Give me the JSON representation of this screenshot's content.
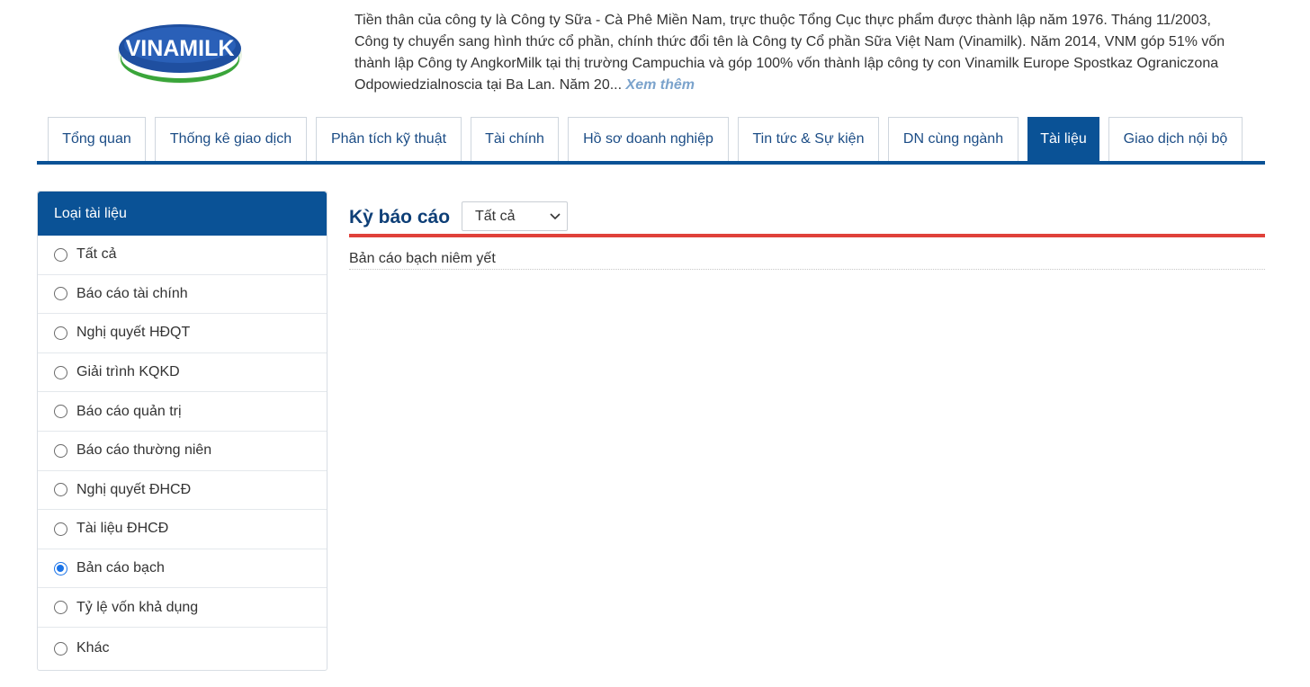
{
  "logo": {
    "text": "VINAMILK",
    "colors": {
      "blue": "#1f4fa0",
      "green": "#3aa53a",
      "white": "#ffffff"
    }
  },
  "intro": {
    "text": "Tiền thân của công ty là Công ty Sữa - Cà Phê Miền Nam, trực thuộc Tổng Cục thực phẩm được thành lập năm 1976. Tháng 11/2003, Công ty chuyển sang hình thức cổ phần, chính thức đổi tên là Công ty Cổ phần Sữa Việt Nam (Vinamilk). Năm 2014, VNM góp 51% vốn thành lập Công ty AngkorMilk tại thị trường Campuchia và góp 100% vốn thành lập công ty con Vinamilk Europe Spostkaz Ograniczona Odpowiedzialnoscia tại Ba Lan. Năm 20...",
    "more_label": "Xem thêm"
  },
  "tabs": [
    {
      "label": "Tổng quan"
    },
    {
      "label": "Thống kê giao dịch"
    },
    {
      "label": "Phân tích kỹ thuật"
    },
    {
      "label": "Tài chính"
    },
    {
      "label": "Hồ sơ doanh nghiệp"
    },
    {
      "label": "Tin tức & Sự kiện"
    },
    {
      "label": "DN cùng ngành"
    },
    {
      "label": "Tài liệu",
      "active": true
    },
    {
      "label": "Giao dịch nội bộ"
    }
  ],
  "sidebar": {
    "title": "Loại tài liệu",
    "items": [
      {
        "label": "Tất cả",
        "checked": false
      },
      {
        "label": "Báo cáo tài chính",
        "checked": false
      },
      {
        "label": "Nghị quyết HĐQT",
        "checked": false
      },
      {
        "label": "Giải trình KQKD",
        "checked": false
      },
      {
        "label": "Báo cáo quản trị",
        "checked": false
      },
      {
        "label": "Báo cáo thường niên",
        "checked": false
      },
      {
        "label": "Nghị quyết ĐHCĐ",
        "checked": false
      },
      {
        "label": "Tài liệu ĐHCĐ",
        "checked": false
      },
      {
        "label": "Bản cáo bạch",
        "checked": true
      },
      {
        "label": "Tỷ lệ vốn khả dụng",
        "checked": false
      },
      {
        "label": "Khác",
        "checked": false
      }
    ]
  },
  "content": {
    "period_label": "Kỳ báo cáo",
    "period_select_value": "Tất cả",
    "documents": [
      {
        "title": "Bản cáo bạch niêm yết"
      }
    ]
  },
  "theme": {
    "primary": "#0a5296",
    "accent_red": "#e0413a",
    "link_muted": "#7ba3cc"
  }
}
